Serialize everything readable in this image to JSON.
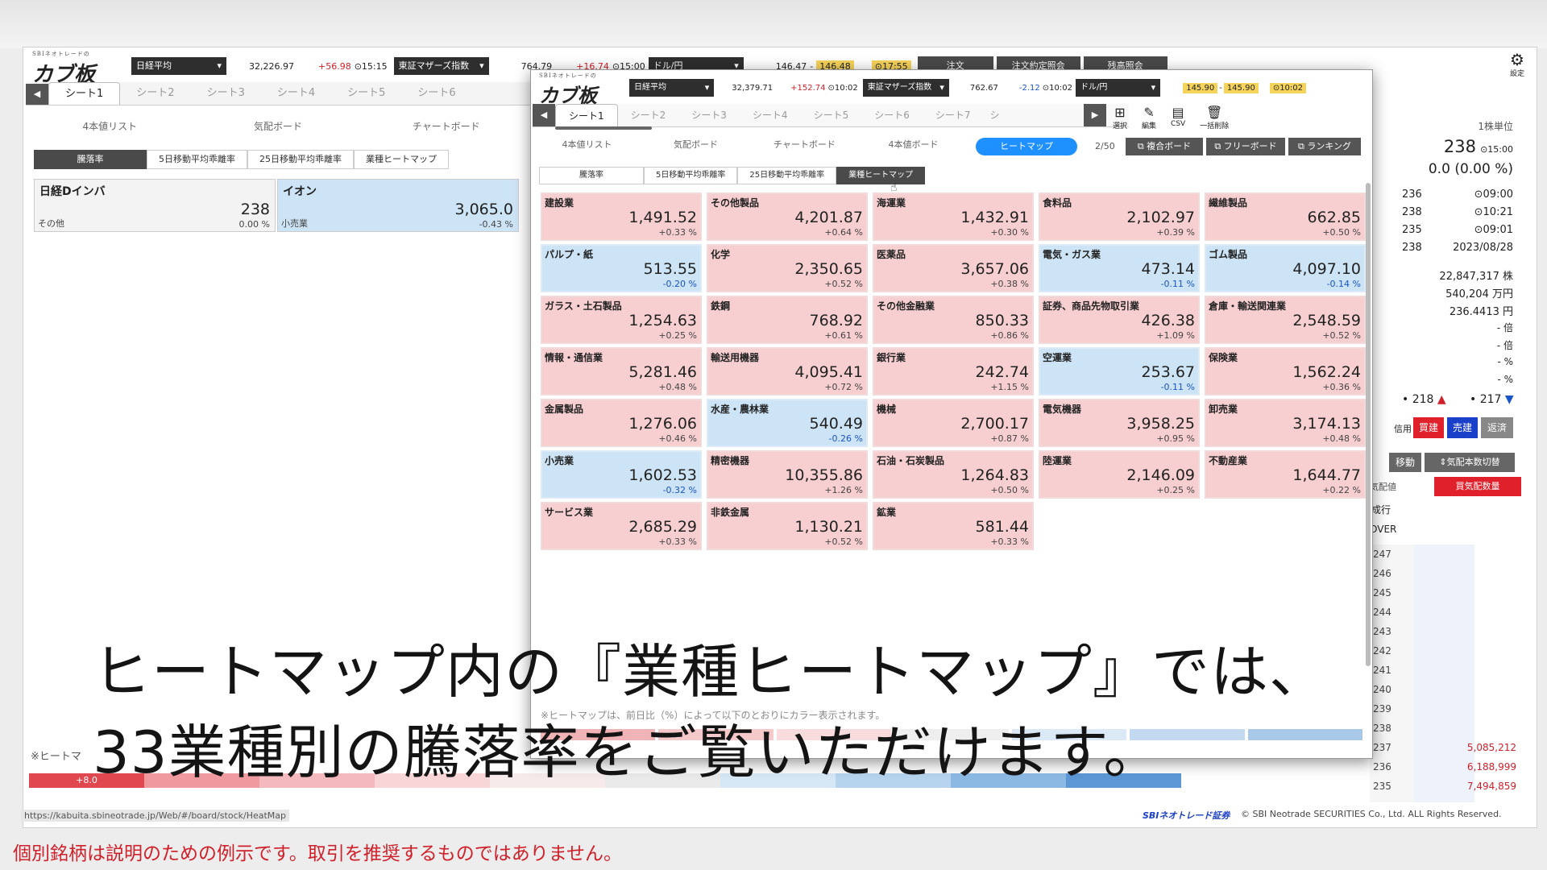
{
  "app": {
    "logo_top": "SBIネオトレードの",
    "logo": "カブ板",
    "settings_label": "設定"
  },
  "bg_ticker": {
    "index1_name": "日経平均",
    "index1_value": "32,226.97",
    "index1_change": "+56.98",
    "index1_time": "⊙15:15",
    "index2_name": "東証マザーズ指数",
    "index2_value": "764.79",
    "index2_change": "+16.74",
    "index2_time": "⊙15:00",
    "fx_name": "ドル/円",
    "fx_bid": "146.47",
    "fx_sep": "-",
    "fx_ask": "146.48",
    "fx_time": "⊙17:55",
    "btn_order": "注文",
    "btn_exec": "注文約定照会",
    "btn_balance": "残高照会"
  },
  "bg_tabs": [
    "シート1",
    "シート2",
    "シート3",
    "シート4",
    "シート5",
    "シート6"
  ],
  "bg_subnav": [
    "4本値リスト",
    "気配ボード",
    "チャートボード"
  ],
  "bg_seg": [
    "騰落率",
    "5日移動平均乖離率",
    "25日移動平均乖離率",
    "業種ヒートマップ"
  ],
  "bg_cards": [
    {
      "name": "日経Dインバ",
      "price": "238",
      "sub": "その他",
      "pct": "0.00 %"
    },
    {
      "name": "イオン",
      "price": "3,065.0",
      "sub": "小売業",
      "pct": "-0.43 %"
    }
  ],
  "bg_legend_label": "※ヒートマ",
  "bg_legend_first": "+8.0",
  "fg_ticker": {
    "index1_name": "日経平均",
    "index1_value": "32,379.71",
    "index1_change": "+152.74",
    "index1_time": "⊙10:02",
    "index2_name": "東証マザーズ指数",
    "index2_value": "762.67",
    "index2_change": "-2.12",
    "index2_time": "⊙10:02",
    "fx_name": "ドル/円",
    "fx_bid": "145.90",
    "fx_sep": "-",
    "fx_ask": "145.90",
    "fx_time": "⊙10:02"
  },
  "fg_tabs": [
    "シート1",
    "シート2",
    "シート3",
    "シート4",
    "シート5",
    "シート6",
    "シート7",
    "シ"
  ],
  "fg_tools": [
    "選択",
    "編集",
    "CSV",
    "一括削除"
  ],
  "fg_subnav": [
    "4本値リスト",
    "気配ボード",
    "チャートボード",
    "4本値ボード"
  ],
  "fg_heatmap_btn": "ヒートマップ",
  "fg_count": "2/50",
  "fg_board_btns": [
    "複合ボード",
    "フリーボード",
    "ランキング"
  ],
  "fg_seg": [
    "騰落率",
    "5日移動平均乖離率",
    "25日移動平均乖離率",
    "業種ヒートマップ"
  ],
  "heatmap_tiles": [
    {
      "name": "建設業",
      "value": "1,491.52",
      "pct": "+0.33 %",
      "tone": "up"
    },
    {
      "name": "その他製品",
      "value": "4,201.87",
      "pct": "+0.64 %",
      "tone": "up"
    },
    {
      "name": "海運業",
      "value": "1,432.91",
      "pct": "+0.30 %",
      "tone": "up"
    },
    {
      "name": "食料品",
      "value": "2,102.97",
      "pct": "+0.39 %",
      "tone": "up"
    },
    {
      "name": "繊維製品",
      "value": "662.85",
      "pct": "+0.50 %",
      "tone": "up"
    },
    {
      "name": "パルプ・紙",
      "value": "513.55",
      "pct": "-0.20 %",
      "tone": "dn"
    },
    {
      "name": "化学",
      "value": "2,350.65",
      "pct": "+0.52 %",
      "tone": "up"
    },
    {
      "name": "医薬品",
      "value": "3,657.06",
      "pct": "+0.38 %",
      "tone": "up"
    },
    {
      "name": "電気・ガス業",
      "value": "473.14",
      "pct": "-0.11 %",
      "tone": "dn"
    },
    {
      "name": "ゴム製品",
      "value": "4,097.10",
      "pct": "-0.14 %",
      "tone": "dn"
    },
    {
      "name": "ガラス・土石製品",
      "value": "1,254.63",
      "pct": "+0.25 %",
      "tone": "up"
    },
    {
      "name": "鉄鋼",
      "value": "768.92",
      "pct": "+0.61 %",
      "tone": "up"
    },
    {
      "name": "その他金融業",
      "value": "850.33",
      "pct": "+0.86 %",
      "tone": "up"
    },
    {
      "name": "証券、商品先物取引業",
      "value": "426.38",
      "pct": "+1.09 %",
      "tone": "up"
    },
    {
      "name": "倉庫・輸送関連業",
      "value": "2,548.59",
      "pct": "+0.52 %",
      "tone": "up"
    },
    {
      "name": "情報・通信業",
      "value": "5,281.46",
      "pct": "+0.48 %",
      "tone": "up"
    },
    {
      "name": "輸送用機器",
      "value": "4,095.41",
      "pct": "+0.72 %",
      "tone": "up"
    },
    {
      "name": "銀行業",
      "value": "242.74",
      "pct": "+1.15 %",
      "tone": "up"
    },
    {
      "name": "空運業",
      "value": "253.67",
      "pct": "-0.11 %",
      "tone": "dn"
    },
    {
      "name": "保険業",
      "value": "1,562.24",
      "pct": "+0.36 %",
      "tone": "up"
    },
    {
      "name": "金属製品",
      "value": "1,276.06",
      "pct": "+0.46 %",
      "tone": "up"
    },
    {
      "name": "水産・農林業",
      "value": "540.49",
      "pct": "-0.26 %",
      "tone": "dn"
    },
    {
      "name": "機械",
      "value": "2,700.17",
      "pct": "+0.87 %",
      "tone": "up"
    },
    {
      "name": "電気機器",
      "value": "3,958.25",
      "pct": "+0.95 %",
      "tone": "up"
    },
    {
      "name": "卸売業",
      "value": "3,174.13",
      "pct": "+0.48 %",
      "tone": "up"
    },
    {
      "name": "小売業",
      "value": "1,602.53",
      "pct": "-0.32 %",
      "tone": "dn"
    },
    {
      "name": "精密機器",
      "value": "10,355.86",
      "pct": "+1.26 %",
      "tone": "up"
    },
    {
      "name": "石油・石炭製品",
      "value": "1,264.83",
      "pct": "+0.50 %",
      "tone": "up"
    },
    {
      "name": "陸運業",
      "value": "2,146.09",
      "pct": "+0.25 %",
      "tone": "up"
    },
    {
      "name": "不動産業",
      "value": "1,644.77",
      "pct": "+0.22 %",
      "tone": "up"
    },
    {
      "name": "サービス業",
      "value": "2,685.29",
      "pct": "+0.33 %",
      "tone": "up"
    },
    {
      "name": "非鉄金属",
      "value": "1,130.21",
      "pct": "+0.52 %",
      "tone": "up"
    },
    {
      "name": "鉱業",
      "value": "581.44",
      "pct": "+0.33 %",
      "tone": "up"
    }
  ],
  "fg_note": "※ヒートマップは、前日比（%）によって以下のとおりにカラー表示されます。",
  "right_panel": {
    "unit": "1株単位",
    "price": "238",
    "price_time": "⊙15:00",
    "change": "0.0",
    "change_pct": "(0.00 %)",
    "rows": [
      {
        "value": "236",
        "time": "⊙09:00"
      },
      {
        "value": "238",
        "time": "⊙10:21"
      },
      {
        "value": "235",
        "time": "⊙09:01"
      },
      {
        "value": "238",
        "time": "2023/08/28"
      }
    ],
    "volume": "22,847,317 株",
    "turnover": "540,204 万円",
    "vwap": "236.4413 円",
    "dash_rows": [
      "- 倍",
      "- 倍",
      "- %",
      "- %"
    ],
    "ask_count": "218",
    "bid_count": "217",
    "credit_label": "信用",
    "btn_buy": "買建",
    "btn_sell": "売建",
    "btn_repay": "返済",
    "btn_move": "移動",
    "btn_switch": "⇕気配本数切替",
    "col_price": "気配値",
    "col_buy_qty": "買気配数量",
    "market_order": "成行",
    "over": "OVER",
    "ladder": [
      "247",
      "246",
      "245",
      "244",
      "243",
      "242",
      "241",
      "240",
      "239",
      "238",
      "237",
      "236",
      "235"
    ],
    "ladder_qty": [
      "5,085,212",
      "6,188,999",
      "7,494,859"
    ]
  },
  "footer": {
    "url": "https://kabuita.sbineotrade.jp/Web/#/board/stock/HeatMap",
    "brand": "SBIネオトレード証券",
    "copyright": "© SBI Neotrade SECURITIES Co., Ltd. ALL Rights Reserved."
  },
  "caption": {
    "line1": "ヒートマップ内の『業種ヒートマップ』では、",
    "line2": "33業種別の騰落率をご覧いただけます。"
  },
  "disclaimer": "個別銘柄は説明のための例示です。取引を推奨するものではありません。",
  "colors": {
    "up_tile": "#f8cfd1",
    "down_tile": "#cde4f6",
    "accent_blue": "#1e90ff",
    "buy_red": "#e0202a",
    "sell_blue": "#1a3fc8",
    "disclaimer_red": "#d0202a"
  }
}
